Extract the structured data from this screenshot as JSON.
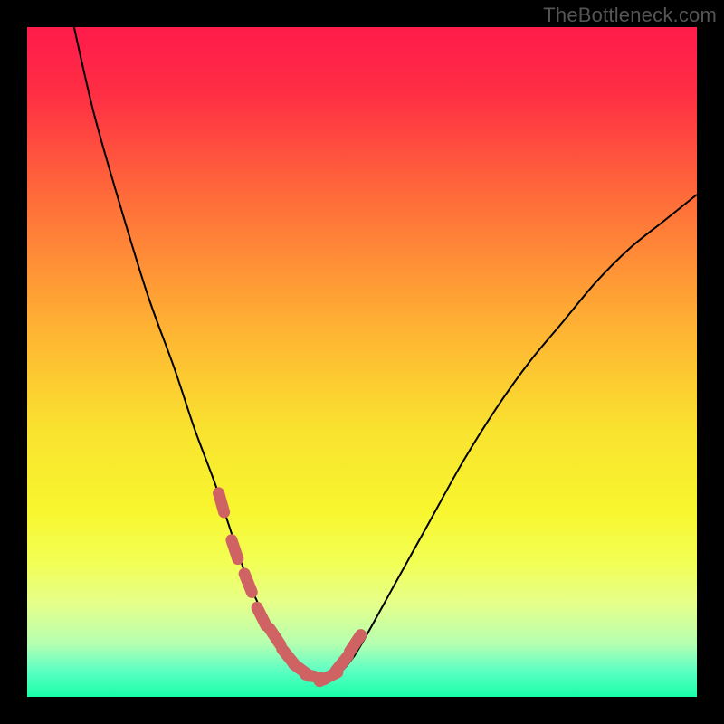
{
  "watermark": "TheBottleneck.com",
  "colors": {
    "frame": "#000000",
    "curve_stroke": "#000000",
    "marker_fill": "#cf6262",
    "gradient_stops": [
      {
        "offset": "0%",
        "color": "#ff1b4b"
      },
      {
        "offset": "10%",
        "color": "#ff2e44"
      },
      {
        "offset": "25%",
        "color": "#ff6a3a"
      },
      {
        "offset": "45%",
        "color": "#ffb333"
      },
      {
        "offset": "60%",
        "color": "#f9e22f"
      },
      {
        "offset": "72%",
        "color": "#f8f62e"
      },
      {
        "offset": "80%",
        "color": "#f2ff55"
      },
      {
        "offset": "86%",
        "color": "#e6ff8a"
      },
      {
        "offset": "92%",
        "color": "#b6ffb0"
      },
      {
        "offset": "96%",
        "color": "#5fffc3"
      },
      {
        "offset": "100%",
        "color": "#18ffa8"
      }
    ]
  },
  "chart_data": {
    "type": "line",
    "title": "",
    "xlabel": "",
    "ylabel": "",
    "xlim": [
      0,
      100
    ],
    "ylim": [
      0,
      100
    ],
    "series": [
      {
        "name": "bottleneck-curve",
        "x": [
          7,
          10,
          14,
          18,
          22,
          25,
          28,
          30,
          32,
          34,
          36,
          38,
          40,
          42,
          44,
          46,
          48,
          50,
          55,
          60,
          65,
          70,
          75,
          80,
          85,
          90,
          95,
          100
        ],
        "y": [
          100,
          87,
          73,
          60,
          49,
          40,
          32,
          26,
          20,
          15,
          11,
          8,
          5,
          3,
          2,
          3,
          5,
          8,
          17,
          26,
          35,
          43,
          50,
          56,
          62,
          67,
          71,
          75
        ]
      }
    ],
    "markers": {
      "name": "highlight-points",
      "x": [
        29,
        31,
        33,
        35,
        37,
        39,
        41,
        43,
        45,
        47,
        49
      ],
      "y": [
        29,
        22,
        17,
        12,
        9,
        6,
        4,
        3,
        3,
        5,
        8
      ]
    }
  }
}
